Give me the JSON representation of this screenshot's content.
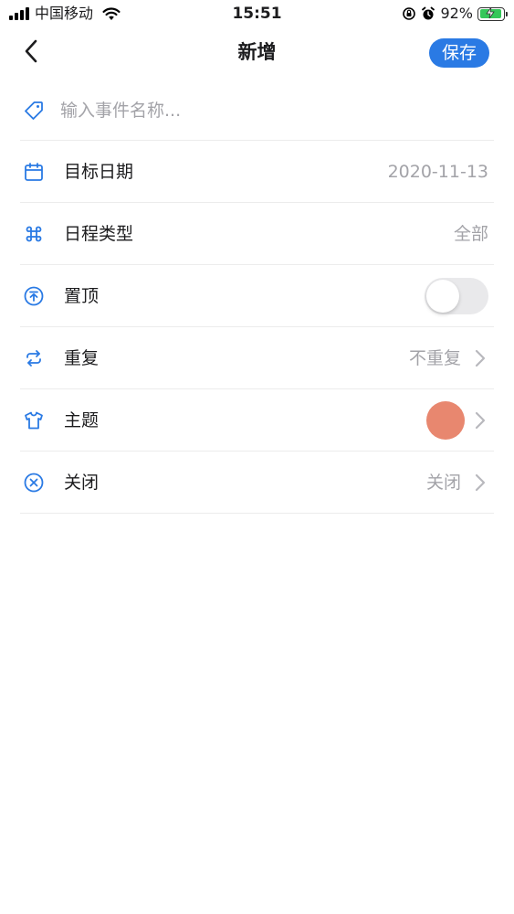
{
  "status_bar": {
    "carrier": "中国移动",
    "time": "15:51",
    "battery_percent": "92%",
    "battery_level": 0.92
  },
  "nav": {
    "title": "新增",
    "save_label": "保存"
  },
  "form": {
    "name_placeholder": "输入事件名称...",
    "name_value": "",
    "rows": [
      {
        "icon": "calendar-icon",
        "label": "目标日期",
        "value": "2020-11-13"
      },
      {
        "icon": "grid-command-icon",
        "label": "日程类型",
        "value": "全部"
      },
      {
        "icon": "pin-top-icon",
        "label": "置顶",
        "toggle_on": false
      },
      {
        "icon": "repeat-icon",
        "label": "重复",
        "value": "不重复"
      },
      {
        "icon": "shirt-icon",
        "label": "主题",
        "swatch_color": "#e8876f"
      },
      {
        "icon": "close-circle-icon",
        "label": "关闭",
        "value": "关闭"
      }
    ]
  },
  "colors": {
    "accent": "#2a7ae4",
    "secondary_text": "#a3a3a8",
    "theme_swatch": "#e8876f",
    "battery": "#34c759"
  }
}
